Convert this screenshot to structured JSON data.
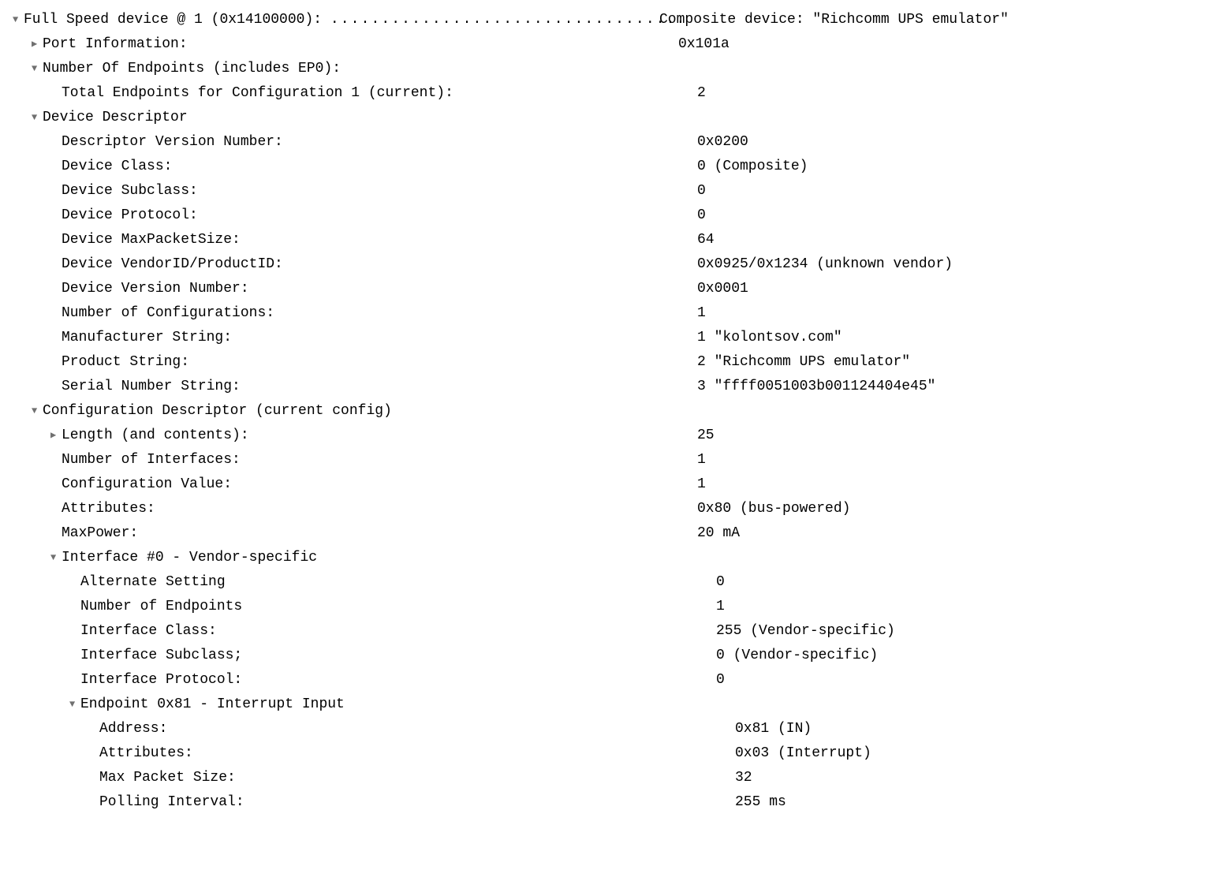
{
  "rows": [
    {
      "indent": 0,
      "arrow": "down",
      "label": "Full Speed device @ 1 (0x14100000):   ",
      "dots": "...................................",
      "value": "   Composite device: \"Richcomm UPS emulator\""
    },
    {
      "indent": 1,
      "arrow": "right",
      "label": "Port Information:",
      "value": "0x101a"
    },
    {
      "indent": 1,
      "arrow": "down",
      "label": "Number Of Endpoints (includes EP0):",
      "value": ""
    },
    {
      "indent": 2,
      "arrow": "",
      "label": "Total Endpoints for Configuration 1 (current):",
      "value": "2"
    },
    {
      "indent": 1,
      "arrow": "down",
      "label": "Device Descriptor",
      "value": ""
    },
    {
      "indent": 2,
      "arrow": "",
      "label": "Descriptor Version Number:",
      "value": "0x0200"
    },
    {
      "indent": 2,
      "arrow": "",
      "label": "Device Class:",
      "value": "0   (Composite)"
    },
    {
      "indent": 2,
      "arrow": "",
      "label": "Device Subclass:",
      "value": "0"
    },
    {
      "indent": 2,
      "arrow": "",
      "label": "Device Protocol:",
      "value": "0"
    },
    {
      "indent": 2,
      "arrow": "",
      "label": "Device MaxPacketSize:",
      "value": "64"
    },
    {
      "indent": 2,
      "arrow": "",
      "label": "Device VendorID/ProductID:",
      "value": "0x0925/0x1234   (unknown vendor)"
    },
    {
      "indent": 2,
      "arrow": "",
      "label": "Device Version Number:",
      "value": "0x0001"
    },
    {
      "indent": 2,
      "arrow": "",
      "label": "Number of Configurations:",
      "value": "1"
    },
    {
      "indent": 2,
      "arrow": "",
      "label": "Manufacturer String:",
      "value": "1 \"kolontsov.com\""
    },
    {
      "indent": 2,
      "arrow": "",
      "label": "Product String:",
      "value": "2 \"Richcomm UPS emulator\""
    },
    {
      "indent": 2,
      "arrow": "",
      "label": "Serial Number String:",
      "value": "3 \"ffff0051003b001124404e45\""
    },
    {
      "indent": 1,
      "arrow": "down",
      "label": "Configuration Descriptor (current config)",
      "value": ""
    },
    {
      "indent": 2,
      "arrow": "right",
      "label": "Length (and contents):",
      "value": "25"
    },
    {
      "indent": 2,
      "arrow": "",
      "label": "Number of Interfaces:",
      "value": "1"
    },
    {
      "indent": 2,
      "arrow": "",
      "label": "Configuration Value:",
      "value": "1"
    },
    {
      "indent": 2,
      "arrow": "",
      "label": "Attributes:",
      "value": "0x80 (bus-powered)"
    },
    {
      "indent": 2,
      "arrow": "",
      "label": "MaxPower:",
      "value": "20 mA"
    },
    {
      "indent": 2,
      "arrow": "down",
      "label": "Interface #0 - Vendor-specific",
      "value": ""
    },
    {
      "indent": 3,
      "arrow": "",
      "label": "Alternate Setting",
      "value": "0"
    },
    {
      "indent": 3,
      "arrow": "",
      "label": "Number of Endpoints",
      "value": "1"
    },
    {
      "indent": 3,
      "arrow": "",
      "label": "Interface Class:",
      "value": "255   (Vendor-specific)"
    },
    {
      "indent": 3,
      "arrow": "",
      "label": "Interface Subclass;",
      "value": "0   (Vendor-specific)"
    },
    {
      "indent": 3,
      "arrow": "",
      "label": "Interface Protocol:",
      "value": "0"
    },
    {
      "indent": 3,
      "arrow": "down",
      "label": "Endpoint 0x81 - Interrupt Input",
      "value": ""
    },
    {
      "indent": 4,
      "arrow": "",
      "label": "Address:",
      "value": "0x81  (IN)"
    },
    {
      "indent": 4,
      "arrow": "",
      "label": "Attributes:",
      "value": "0x03  (Interrupt)"
    },
    {
      "indent": 4,
      "arrow": "",
      "label": "Max Packet Size:",
      "value": "32"
    },
    {
      "indent": 4,
      "arrow": "",
      "label": "Polling Interval:",
      "value": "255 ms"
    }
  ]
}
